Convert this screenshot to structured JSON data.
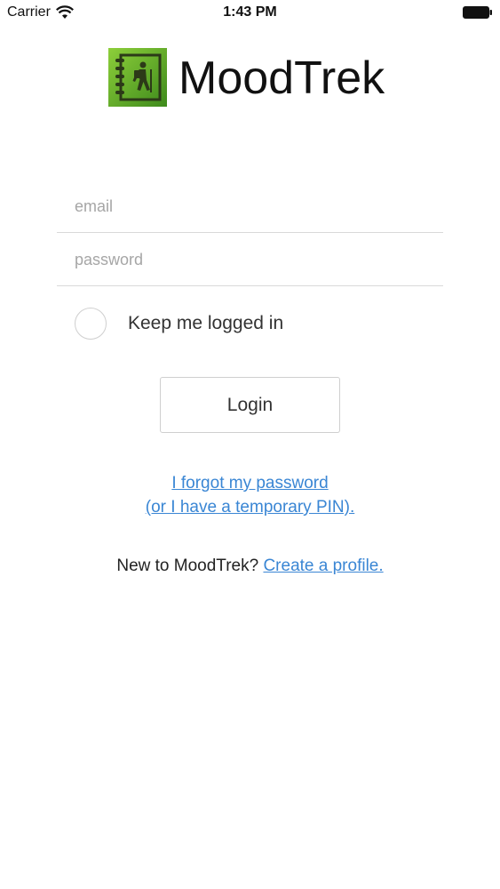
{
  "status_bar": {
    "carrier": "Carrier",
    "time": "1:43 PM"
  },
  "header": {
    "app_name": "MoodTrek",
    "logo_icon": "hiker-journal-icon",
    "logo_color": "#5fa82a"
  },
  "form": {
    "email_placeholder": "email",
    "email_value": "",
    "password_placeholder": "password",
    "password_value": "",
    "keep_logged_in_label": "Keep me logged in",
    "keep_logged_in_checked": false,
    "login_label": "Login"
  },
  "links": {
    "forgot_line1": "I forgot my password",
    "forgot_line2": "(or I have a temporary PIN).",
    "new_prompt": "New to MoodTrek?",
    "create_profile": "Create a profile.",
    "link_color": "#3a86d4"
  }
}
